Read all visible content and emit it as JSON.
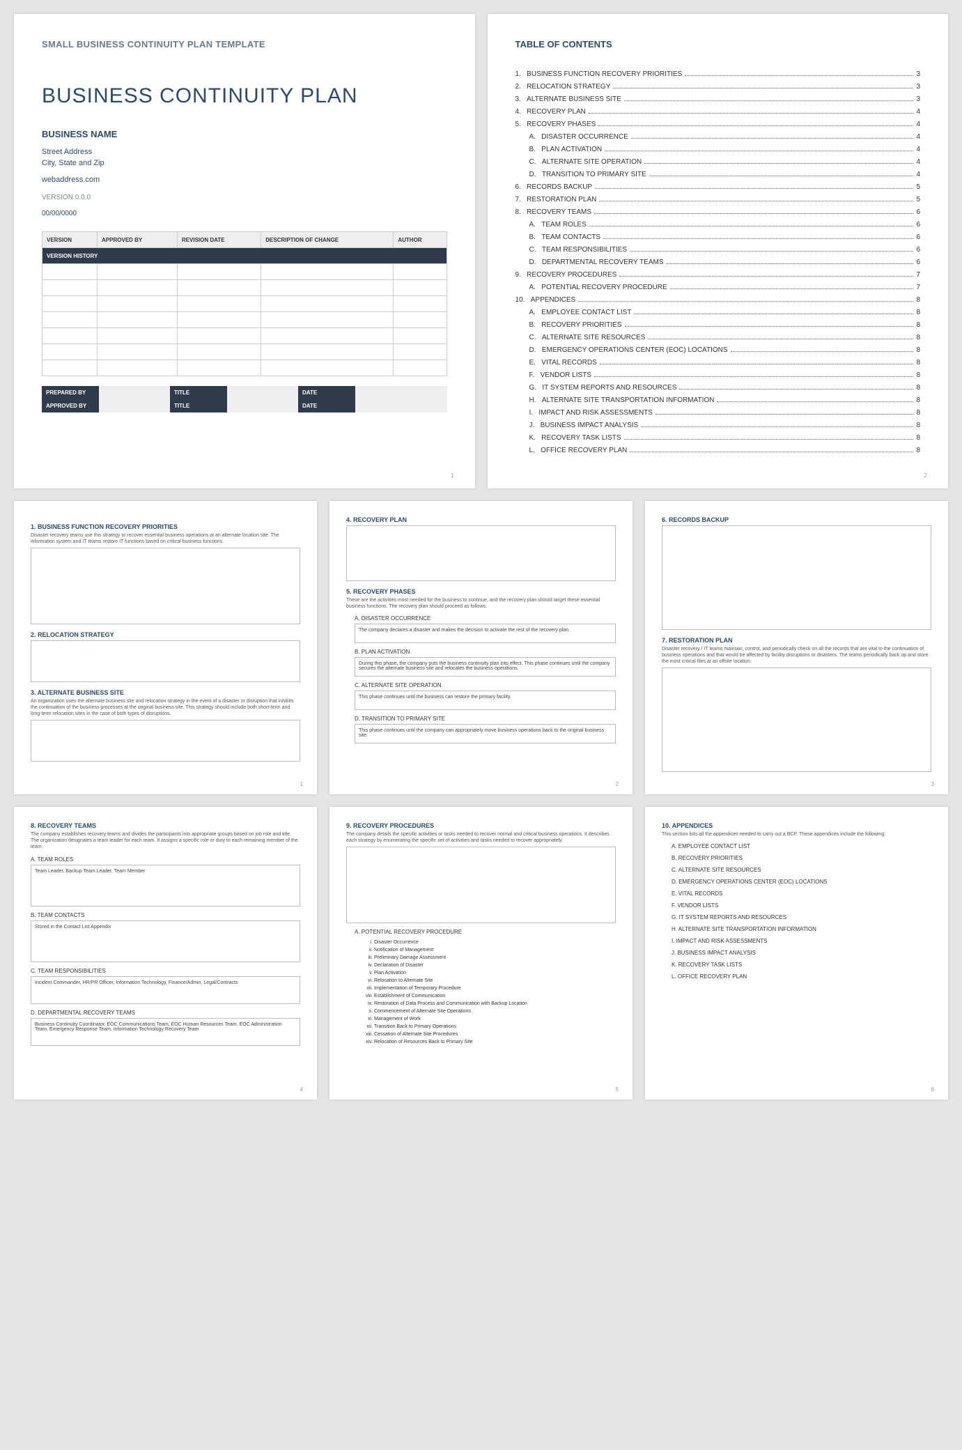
{
  "page1": {
    "pretitle": "SMALL BUSINESS CONTINUITY PLAN TEMPLATE",
    "title": "BUSINESS CONTINUITY PLAN",
    "bizname": "BUSINESS NAME",
    "street": "Street Address",
    "city": "City, State and Zip",
    "web": "webaddress.com",
    "version": "VERSION 0.0.0",
    "date": "00/00/0000",
    "vh_header": "VERSION HISTORY",
    "vh_cols": [
      "VERSION",
      "APPROVED BY",
      "REVISION DATE",
      "DESCRIPTION OF CHANGE",
      "AUTHOR"
    ],
    "sig": {
      "prepared": "PREPARED BY",
      "approved": "APPROVED BY",
      "title": "TITLE",
      "date": "DATE"
    },
    "pg": "1"
  },
  "toc": {
    "title": "TABLE OF CONTENTS",
    "items": [
      {
        "n": "1.",
        "t": "BUSINESS FUNCTION RECOVERY PRIORITIES",
        "p": "3"
      },
      {
        "n": "2.",
        "t": "RELOCATION STRATEGY",
        "p": "3"
      },
      {
        "n": "3.",
        "t": "ALTERNATE BUSINESS SITE",
        "p": "3"
      },
      {
        "n": "4.",
        "t": "RECOVERY PLAN",
        "p": "4"
      },
      {
        "n": "5.",
        "t": "RECOVERY PHASES",
        "p": "4"
      },
      {
        "n": "A.",
        "t": "DISASTER OCCURRENCE",
        "p": "4",
        "s": true
      },
      {
        "n": "B.",
        "t": "PLAN ACTIVATION",
        "p": "4",
        "s": true
      },
      {
        "n": "C.",
        "t": "ALTERNATE SITE OPERATION",
        "p": "4",
        "s": true
      },
      {
        "n": "D.",
        "t": "TRANSITION TO PRIMARY SITE",
        "p": "4",
        "s": true
      },
      {
        "n": "6.",
        "t": "RECORDS BACKUP",
        "p": "5"
      },
      {
        "n": "7.",
        "t": "RESTORATION PLAN",
        "p": "5"
      },
      {
        "n": "8.",
        "t": "RECOVERY TEAMS",
        "p": "6"
      },
      {
        "n": "A.",
        "t": "TEAM ROLES",
        "p": "6",
        "s": true
      },
      {
        "n": "B.",
        "t": "TEAM CONTACTS",
        "p": "6",
        "s": true
      },
      {
        "n": "C.",
        "t": "TEAM RESPONSIBILITIES",
        "p": "6",
        "s": true
      },
      {
        "n": "D.",
        "t": "DEPARTMENTAL RECOVERY TEAMS",
        "p": "6",
        "s": true
      },
      {
        "n": "9.",
        "t": "RECOVERY PROCEDURES",
        "p": "7"
      },
      {
        "n": "A.",
        "t": "POTENTIAL RECOVERY PROCEDURE",
        "p": "7",
        "s": true
      },
      {
        "n": "10.",
        "t": "APPENDICES",
        "p": "8"
      },
      {
        "n": "A.",
        "t": "EMPLOYEE CONTACT LIST",
        "p": "8",
        "s": true
      },
      {
        "n": "B.",
        "t": "RECOVERY PRIORITIES",
        "p": "8",
        "s": true
      },
      {
        "n": "C.",
        "t": "ALTERNATE SITE RESOURCES",
        "p": "8",
        "s": true
      },
      {
        "n": "D.",
        "t": "EMERGENCY OPERATIONS CENTER (EOC) LOCATIONS",
        "p": "8",
        "s": true
      },
      {
        "n": "E.",
        "t": "VITAL RECORDS",
        "p": "8",
        "s": true
      },
      {
        "n": "F.",
        "t": "VENDOR LISTS",
        "p": "8",
        "s": true
      },
      {
        "n": "G.",
        "t": "IT SYSTEM REPORTS AND RESOURCES",
        "p": "8",
        "s": true
      },
      {
        "n": "H.",
        "t": "ALTERNATE SITE TRANSPORTATION INFORMATION",
        "p": "8",
        "s": true
      },
      {
        "n": "I.",
        "t": "IMPACT AND RISK ASSESSMENTS",
        "p": "8",
        "s": true
      },
      {
        "n": "J.",
        "t": "BUSINESS IMPACT ANALYSIS",
        "p": "8",
        "s": true
      },
      {
        "n": "K.",
        "t": "RECOVERY TASK LISTS",
        "p": "8",
        "s": true
      },
      {
        "n": "L.",
        "t": "OFFICE RECOVERY PLAN",
        "p": "8",
        "s": true
      }
    ],
    "pg": "2"
  },
  "p3": {
    "s1": {
      "h": "1. BUSINESS FUNCTION RECOVERY PRIORITIES",
      "d": "Disaster recovery teams use this strategy to recover essential business operations at an alternate location site. The information system and IT teams restore IT functions based on critical business functions."
    },
    "s2": {
      "h": "2. RELOCATION STRATEGY"
    },
    "s3": {
      "h": "3. ALTERNATE BUSINESS SITE",
      "d": "An organization uses the alternate business site and relocation strategy in the event of a disaster or disruption that inhibits the continuation of the business processes at the original business site. This strategy should include both short-term and long-term relocation sites in the case of both types of disruptions."
    },
    "pg": "1"
  },
  "p4": {
    "s4": {
      "h": "4. RECOVERY PLAN"
    },
    "s5": {
      "h": "5. RECOVERY PHASES",
      "d": "These are the activities most needed for the business to continue, and the recovery plan should target these essential business functions. The recovery plan should proceed as follows:"
    },
    "a": {
      "h": "A. DISASTER OCCURRENCE",
      "d": "The company declares a disaster and makes the decision to activate the rest of the recovery plan."
    },
    "b": {
      "h": "B. PLAN ACTIVATION",
      "d": "During this phase, the company puts the business continuity plan into effect. This phase continues until the company secures the alternate business site and relocates the business operations."
    },
    "c": {
      "h": "C. ALTERNATE SITE OPERATION",
      "d": "This phase continues until the business can restore the primary facility."
    },
    "dph": {
      "h": "D. TRANSITION TO PRIMARY SITE",
      "d": "This phase continues until the company can appropriately move business operations back to the original business site."
    },
    "pg": "2"
  },
  "p5": {
    "s6": {
      "h": "6. RECORDS BACKUP"
    },
    "s7": {
      "h": "7. RESTORATION PLAN",
      "d": "Disaster recovery / IT teams maintain, control, and periodically check on all the records that are vital to the continuation of business operations and that would be affected by facility disruptions or disasters. The teams periodically back up and store the most critical files at an offsite location."
    },
    "pg": "3"
  },
  "p6": {
    "s8": {
      "h": "8. RECOVERY TEAMS",
      "d": "The company establishes recovery teams and divides the participants into appropriate groups based on job role and title. The organization designates a team leader for each team. It assigns a specific role or duty to each remaining member of the team."
    },
    "a": {
      "h": "A. TEAM ROLES",
      "d": "Team Leader, Backup Team Leader, Team Member"
    },
    "b": {
      "h": "B. TEAM CONTACTS",
      "d": "Stored in the Contact List Appendix"
    },
    "c": {
      "h": "C. TEAM RESPONSIBILITIES",
      "d": "Incident Commander, HR/PR Officer, Information Technology, Finance/Admin, Legal/Contracts"
    },
    "dteam": {
      "h": "D. DEPARTMENTAL RECOVERY TEAMS",
      "d": "Business Continuity Coordinator, EOC Communications Team, EOC Human Resources Team, EOC Administration Team, Emergency Response Team, Information Technology Recovery Team"
    },
    "pg": "4"
  },
  "p7": {
    "s9": {
      "h": "9. RECOVERY PROCEDURES",
      "d": "The company details the specific activities or tasks needed to recover normal and critical business operations. It describes each strategy by enumerating the specific set of activities and tasks needed to recover appropriately."
    },
    "a": {
      "h": "A. POTENTIAL RECOVERY PROCEDURE"
    },
    "steps": [
      "Disaster Occurrence",
      "Notification of Management",
      "Preliminary Damage Assessment",
      "Declaration of Disaster",
      "Plan Activation",
      "Relocation to Alternate Site",
      "Implementation of Temporary Procedure",
      "Establishment of Communication",
      "Restoration of Data Process and Communication with Backup Location",
      "Commencement of Alternate Site Operations",
      "Management of Work",
      "Transition Back to Primary Operations",
      "Cessation of Alternate Site Procedures",
      "Relocation of Resources Back to Primary Site"
    ],
    "pg": "5"
  },
  "p8": {
    "h": "10.   APPENDICES",
    "d": "This section lists all the appendices needed to carry out a BCP. These appendices include the following:",
    "items": [
      "A. EMPLOYEE CONTACT LIST",
      "B. RECOVERY PRIORITIES",
      "C. ALTERNATE SITE RESOURCES",
      "D. EMERGENCY OPERATIONS CENTER (EOC) LOCATIONS",
      "E. VITAL RECORDS",
      "F. VENDOR LISTS",
      "G. IT SYSTEM REPORTS AND RESOURCES",
      "H. ALTERNATE SITE TRANSPORTATION INFORMATION",
      "I. IMPACT AND RISK ASSESSMENTS",
      "J. BUSINESS IMPACT ANALYSIS",
      "K. RECOVERY TASK LISTS",
      "L. OFFICE RECOVERY PLAN"
    ],
    "pg": "6"
  }
}
